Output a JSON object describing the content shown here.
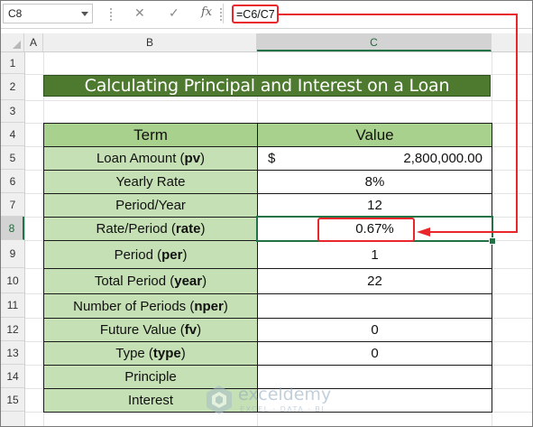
{
  "formula_bar": {
    "name_box": "C8",
    "formula": "=C6/C7",
    "cancel_icon": "✕",
    "enter_icon": "✓",
    "fx_label": "fx"
  },
  "columns": [
    "A",
    "B",
    "C"
  ],
  "rows": [
    "1",
    "2",
    "3",
    "4",
    "5",
    "6",
    "7",
    "8",
    "9",
    "10",
    "11",
    "12",
    "13",
    "14",
    "15"
  ],
  "title": "Calculating Principal and Interest on a Loan",
  "table": {
    "header": {
      "term": "Term",
      "value": "Value"
    },
    "rows": [
      {
        "term": "Loan Amount (",
        "arg": "pv",
        "close": ")",
        "currency": "$",
        "value": "2,800,000.00"
      },
      {
        "term": "Yearly Rate",
        "arg": "",
        "close": "",
        "value": "8%"
      },
      {
        "term": "Period/Year",
        "arg": "",
        "close": "",
        "value": "12"
      },
      {
        "term": "Rate/Period (",
        "arg": "rate",
        "close": ")",
        "value": "0.67%"
      },
      {
        "term": "Period (",
        "arg": "per",
        "close": ")",
        "value": "1"
      },
      {
        "term": "Total Period (",
        "arg": "year",
        "close": ")",
        "value": "22"
      },
      {
        "term": "Number of Periods (",
        "arg": "nper",
        "close": ")",
        "value": ""
      },
      {
        "term": "Future Value (",
        "arg": "fv",
        "close": ")",
        "value": "0"
      },
      {
        "term": "Type (",
        "arg": "type",
        "close": ")",
        "value": "0"
      },
      {
        "term": "Principle",
        "arg": "",
        "close": "",
        "value": ""
      },
      {
        "term": "Interest",
        "arg": "",
        "close": "",
        "value": ""
      }
    ]
  },
  "selected_cell": "C8",
  "watermark": {
    "name": "exceldemy",
    "tagline": "EXCEL · DATA · BI"
  },
  "colors": {
    "title_bg": "#4e7a2f",
    "header_bg": "#a9d18e",
    "label_bg": "#c5e0b4",
    "annotation": "#e8262b",
    "selection": "#217346"
  }
}
